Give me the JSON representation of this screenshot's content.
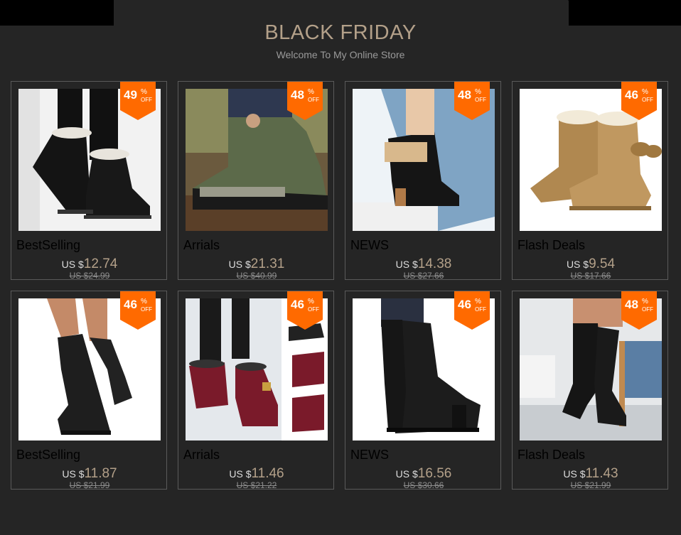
{
  "header": {
    "title": "BLACK FRIDAY",
    "subtitle": "Welcome To My Online Store"
  },
  "colors": {
    "background": "#252525",
    "title": "#b3a089",
    "badge": "#ff6a00",
    "price": "#b3a089"
  },
  "products": [
    {
      "category": "BestSelling",
      "currency": "US $",
      "price": "12.74",
      "old_price": "US $24.99",
      "discount": "49",
      "pct": "%",
      "off": "OFF",
      "icon": "black-snow-boot-image"
    },
    {
      "category": "Arrials",
      "currency": "US $",
      "price": "21.31",
      "old_price": "US $40.99",
      "discount": "48",
      "pct": "%",
      "off": "OFF",
      "icon": "green-hiking-boot-image"
    },
    {
      "category": "NEWS",
      "currency": "US $",
      "price": "14.38",
      "old_price": "US $27.66",
      "discount": "48",
      "pct": "%",
      "off": "OFF",
      "icon": "black-fur-ankle-boot-image"
    },
    {
      "category": "Flash Deals",
      "currency": "US $",
      "price": "9.54",
      "old_price": "US $17.66",
      "discount": "46",
      "pct": "%",
      "off": "OFF",
      "icon": "tan-bow-snow-boot-image"
    },
    {
      "category": "BestSelling",
      "currency": "US $",
      "price": "11.87",
      "old_price": "US $21.99",
      "discount": "46",
      "pct": "%",
      "off": "OFF",
      "icon": "black-slouch-knee-boot-image"
    },
    {
      "category": "Arrials",
      "currency": "US $",
      "price": "11.46",
      "old_price": "US $21.22",
      "discount": "46",
      "pct": "%",
      "off": "OFF",
      "icon": "burgundy-ankle-boot-image"
    },
    {
      "category": "NEWS",
      "currency": "US $",
      "price": "16.56",
      "old_price": "US $30.66",
      "discount": "46",
      "pct": "%",
      "off": "OFF",
      "icon": "black-leather-knee-boot-image"
    },
    {
      "category": "Flash Deals",
      "currency": "US $",
      "price": "11.43",
      "old_price": "US $21.99",
      "discount": "48",
      "pct": "%",
      "off": "OFF",
      "icon": "black-heeled-knee-boot-image"
    }
  ]
}
